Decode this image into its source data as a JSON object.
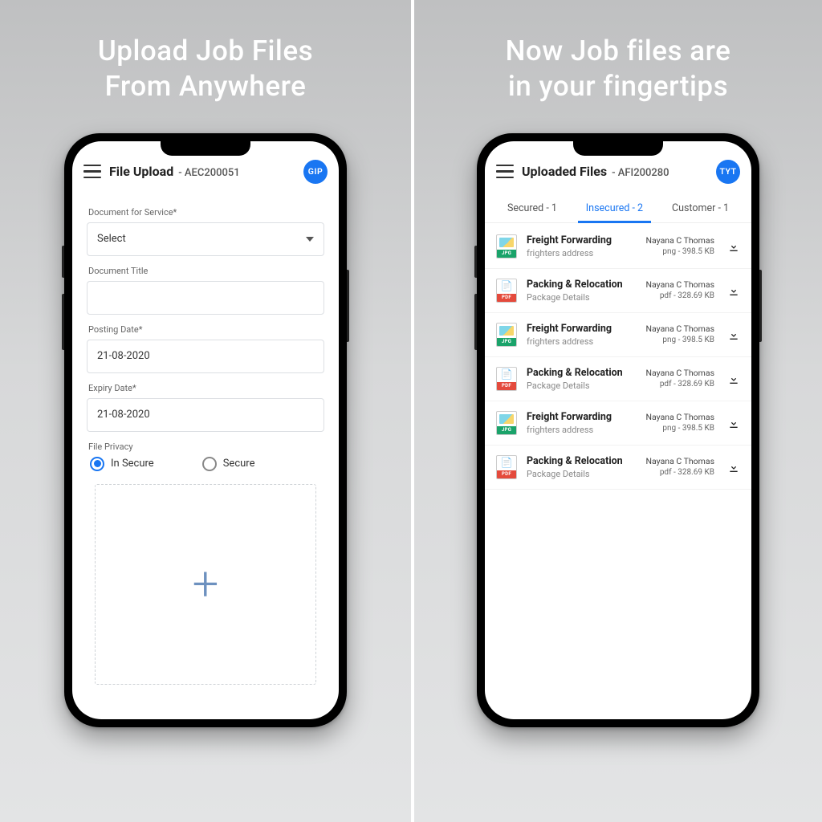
{
  "left": {
    "promo_line1": "Upload Job Files",
    "promo_line2": "From Anywhere",
    "header": {
      "title": "File Upload",
      "subtitle": "- AEC200051",
      "avatar": "GIP"
    },
    "form": {
      "service_label": "Document for Service*",
      "service_value": "Select",
      "title_label": "Document Title",
      "title_value": "",
      "posting_label": "Posting Date*",
      "posting_value": "21-08-2020",
      "expiry_label": "Expiry Date*",
      "expiry_value": "21-08-2020",
      "privacy_label": "File Privacy",
      "radio_insecure": "In Secure",
      "radio_secure": "Secure"
    }
  },
  "right": {
    "promo_line1": "Now Job files are",
    "promo_line2": "in your fingertips",
    "header": {
      "title": "Uploaded Files",
      "subtitle": "- AFI200280",
      "avatar": "TYT"
    },
    "tabs": {
      "secured": "Secured - 1",
      "insecured": "Insecured - 2",
      "customer": "Customer - 1"
    },
    "files": [
      {
        "type": "jpg",
        "title": "Freight Forwarding",
        "sub": "frighters address",
        "user": "Nayana C Thomas",
        "meta": "png - 398.5 KB"
      },
      {
        "type": "pdf",
        "title": "Packing & Relocation",
        "sub": "Package Details",
        "user": "Nayana C Thomas",
        "meta": "pdf - 328.69 KB"
      },
      {
        "type": "jpg",
        "title": "Freight Forwarding",
        "sub": "frighters address",
        "user": "Nayana C Thomas",
        "meta": "png - 398.5 KB"
      },
      {
        "type": "pdf",
        "title": "Packing & Relocation",
        "sub": "Package Details",
        "user": "Nayana C Thomas",
        "meta": "pdf - 328.69 KB"
      },
      {
        "type": "jpg",
        "title": "Freight Forwarding",
        "sub": "frighters address",
        "user": "Nayana C Thomas",
        "meta": "png - 398.5 KB"
      },
      {
        "type": "pdf",
        "title": "Packing & Relocation",
        "sub": "Package Details",
        "user": "Nayana C Thomas",
        "meta": "pdf - 328.69 KB"
      }
    ],
    "file_type_labels": {
      "jpg": "JPG",
      "pdf": "PDF"
    }
  }
}
